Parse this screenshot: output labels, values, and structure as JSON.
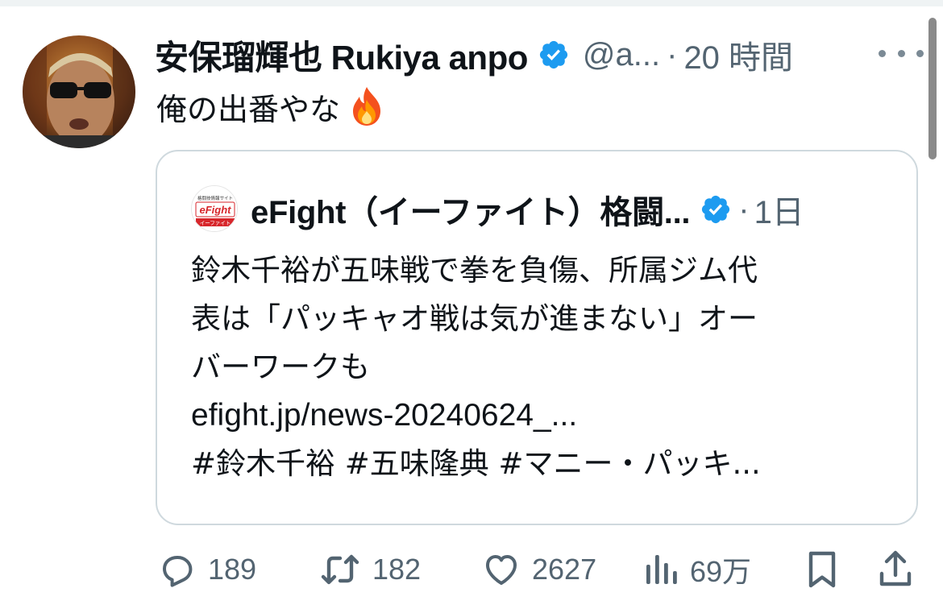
{
  "tweet": {
    "author_name": "安保瑠輝也 Rukiya anpo",
    "handle": "@a...",
    "separator": "·",
    "time": "20 時間",
    "text": "俺の出番やな",
    "emoji": "fire-emoji"
  },
  "quote": {
    "author_name": "eFight（イーファイト）格闘...",
    "separator": "·",
    "time": "1日",
    "lines": [
      "鈴木千裕が五味戦で拳を負傷、所属ジム代",
      "表は「パッキャオ戦は気が進まない」オー",
      "バーワークも"
    ],
    "link": "efight.jp/news-20240624_...",
    "hashtags": "#鈴木千裕 #五味隆典 #マニー・パッキ...",
    "logo_text_top": "格闘技情報サイト",
    "logo_text_main": "eFight",
    "logo_text_bottom": "イーファイト"
  },
  "actions": {
    "replies": "189",
    "reposts": "182",
    "likes": "2627",
    "views": "69万"
  },
  "colors": {
    "verified": "#1d9bf0",
    "secondary_text": "#536471",
    "border": "#cfd9de",
    "logo_red": "#d7262b"
  },
  "icons": [
    "verified-badge-icon",
    "more-icon",
    "reply-icon",
    "repost-icon",
    "like-icon",
    "views-icon",
    "bookmark-icon",
    "share-icon"
  ]
}
